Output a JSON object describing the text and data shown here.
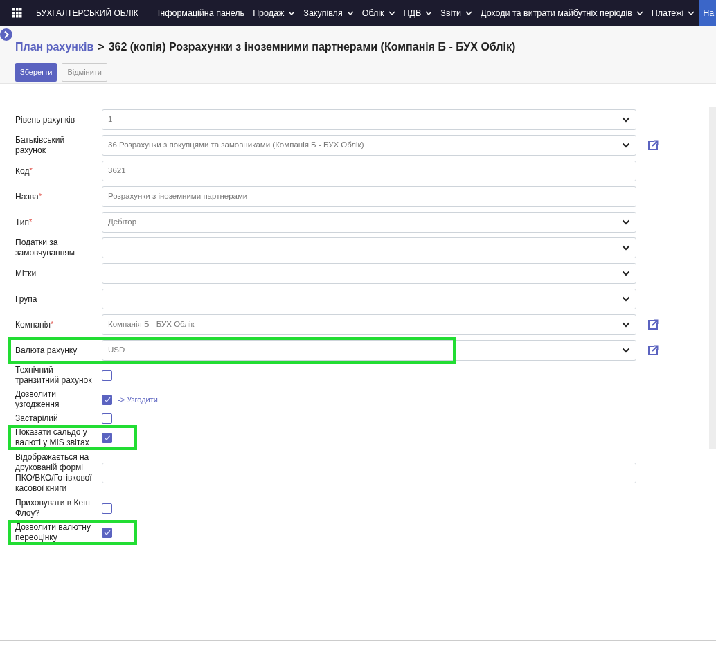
{
  "app_title": "БУХГАЛТЕРСЬКИЙ ОБЛІК",
  "menu": [
    {
      "label": "Інформаційна панель",
      "dropdown": false,
      "selected": false
    },
    {
      "label": "Продаж",
      "dropdown": true,
      "selected": false
    },
    {
      "label": "Закупівля",
      "dropdown": true,
      "selected": false
    },
    {
      "label": "Облік",
      "dropdown": true,
      "selected": false
    },
    {
      "label": "ПДВ",
      "dropdown": true,
      "selected": false
    },
    {
      "label": "Звіти",
      "dropdown": true,
      "selected": false
    },
    {
      "label": "Доходи та витрати майбутніх періодів",
      "dropdown": true,
      "selected": false
    },
    {
      "label": "Платежі",
      "dropdown": true,
      "selected": false
    },
    {
      "label": "На",
      "dropdown": false,
      "selected": true
    }
  ],
  "breadcrumb": {
    "parent": "План рахунків",
    "separator": ">",
    "current": "362 (копія) Розрахунки з іноземними партнерами (Компанія Б - БУХ Облік)"
  },
  "buttons": [
    {
      "label": "Зберегти",
      "kind": "primary"
    },
    {
      "label": "Відмінити",
      "kind": "secondary"
    }
  ],
  "fields": [
    {
      "label": "Рівень рахунків",
      "kind": "select",
      "value": "1",
      "external_link": false,
      "highlighted": false
    },
    {
      "label": "Батьківський рахунок",
      "kind": "select",
      "value": "36 Розрахунки з покупцями та замовниками (Компанія Б - БУХ Облік)",
      "external_link": true,
      "highlighted": false
    },
    {
      "label": "Код",
      "kind": "input",
      "value": "3621",
      "required_mark": "*",
      "external_link": false,
      "highlighted": false
    },
    {
      "label": "Назва",
      "kind": "input",
      "value": "Розрахунки з іноземними партнерами",
      "required_mark": "*",
      "external_link": false,
      "highlighted": false
    },
    {
      "label": "Тип",
      "kind": "select",
      "value": "Дебітор",
      "required_mark": "*",
      "external_link": false,
      "highlighted": false
    },
    {
      "label": "Податки за замовчуванням",
      "kind": "select",
      "external_link": false,
      "highlighted": false
    },
    {
      "label": "Мітки",
      "kind": "select",
      "external_link": false,
      "highlighted": false
    },
    {
      "label": "Група",
      "kind": "select",
      "external_link": false,
      "highlighted": false
    },
    {
      "label": "Компанія",
      "kind": "select",
      "value": "Компанія Б - БУХ Облік",
      "required_mark": "*",
      "external_link": true,
      "highlighted": false
    },
    {
      "label": "Валюта рахунку",
      "kind": "select",
      "value": "USD",
      "external_link": true,
      "highlighted": true
    },
    {
      "label": "Технічний транзитний рахунок",
      "kind": "checkbox",
      "checked": false,
      "highlighted": false
    },
    {
      "label": "Дозволити узгодження",
      "kind": "checkbox",
      "checked": true,
      "link": "-> Узгодити",
      "highlighted": false
    },
    {
      "label": "Застарілий",
      "kind": "checkbox",
      "checked": false,
      "highlighted": false
    },
    {
      "label": "Показати сальдо у валюті у MIS звітах",
      "kind": "checkbox",
      "checked": true,
      "highlighted": true
    },
    {
      "label": "Відображається на друкованій формі ПКО/ВКО/Готівкової касової книги",
      "kind": "input",
      "external_link": false,
      "highlighted": false
    },
    {
      "label": "Приховувати в Кеш Флоу?",
      "kind": "checkbox",
      "checked": false,
      "highlighted": false
    },
    {
      "label": "Дозволити валютну переоцінку",
      "kind": "checkbox",
      "checked": true,
      "highlighted": true
    }
  ]
}
